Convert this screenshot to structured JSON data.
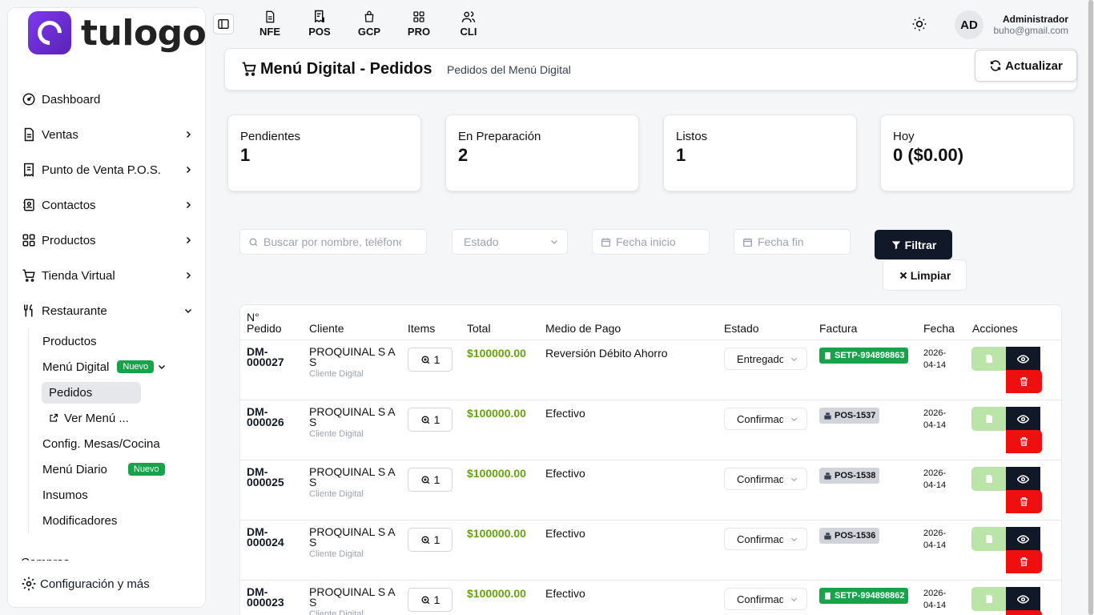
{
  "brand": {
    "name": "tulogo"
  },
  "sidebar": {
    "items": [
      {
        "label": "Dashboard",
        "icon": "gauge-icon",
        "chevron": ""
      },
      {
        "label": "Ventas",
        "icon": "file-invoice-icon",
        "chevron": "right"
      },
      {
        "label": "Punto de Venta P.O.S.",
        "icon": "receipt-icon",
        "chevron": "right"
      },
      {
        "label": "Contactos",
        "icon": "address-book-icon",
        "chevron": "right"
      },
      {
        "label": "Productos",
        "icon": "grid-icon",
        "chevron": "right"
      },
      {
        "label": "Tienda Virtual",
        "icon": "cart-icon",
        "chevron": "right"
      },
      {
        "label": "Restaurante",
        "icon": "utensils-icon",
        "chevron": "down"
      }
    ],
    "restaurant_sub": {
      "productos": "Productos",
      "menu_digital": "Menú Digital",
      "menu_digital_badge": "Nuevo",
      "pedidos": "Pedidos",
      "ver_menu": "Ver Menú ...",
      "config_mesas": "Config. Mesas/Cocina",
      "menu_diario": "Menú Diario",
      "menu_diario_badge": "Nuevo",
      "insumos": "Insumos",
      "modificadores": "Modificadores"
    },
    "cut_item": "Compras",
    "footer": "Configuración y más"
  },
  "topbar": {
    "modules": [
      {
        "label": "NFE",
        "icon": "file-icon"
      },
      {
        "label": "POS",
        "icon": "receipt-dollar-icon"
      },
      {
        "label": "GCP",
        "icon": "bag-icon"
      },
      {
        "label": "PRO",
        "icon": "grid-icon"
      },
      {
        "label": "CLI",
        "icon": "users-icon"
      }
    ],
    "avatar": "AD",
    "user_name": "Administrador",
    "user_email": "buho@gmail.com"
  },
  "header": {
    "title": "Menú Digital - Pedidos",
    "subtitle": "Pedidos del Menú Digital",
    "refresh_label": "Actualizar"
  },
  "stats": [
    {
      "label": "Pendientes",
      "value": "1"
    },
    {
      "label": "En Preparación",
      "value": "2"
    },
    {
      "label": "Listos",
      "value": "1"
    },
    {
      "label": "Hoy",
      "value": "0 ($0.00)"
    }
  ],
  "filters": {
    "search_placeholder": "Buscar por nombre, teléfono",
    "estado_placeholder": "Estado",
    "fecha_inicio_placeholder": "Fecha inicio",
    "fecha_fin_placeholder": "Fecha fin",
    "filter_label": "Filtrar",
    "clear_label": "Limpiar"
  },
  "table": {
    "headers": {
      "pedido_1": "N°",
      "pedido_2": "Pedido",
      "cliente": "Cliente",
      "items": "Items",
      "total": "Total",
      "medio_pago": "Medio de Pago",
      "estado": "Estado",
      "factura": "Factura",
      "fecha": "Fecha",
      "acciones": "Acciones"
    },
    "rows": [
      {
        "id_1": "DM-",
        "id_2": "000027",
        "cliente_1": "PROQUINAL S A",
        "cliente_2": "S",
        "cliente_sub": "Cliente Digital",
        "items": "1",
        "total": "$100000.00",
        "pago": "Reversión Débito Ahorro",
        "estado": "Entregado",
        "factura": "SETP-994898863",
        "factura_type": "green",
        "fecha_1": "2026-",
        "fecha_2": "04-14"
      },
      {
        "id_1": "DM-",
        "id_2": "000026",
        "cliente_1": "PROQUINAL S A",
        "cliente_2": "S",
        "cliente_sub": "Cliente Digital",
        "items": "1",
        "total": "$100000.00",
        "pago": "Efectivo",
        "estado": "Confirmado",
        "factura": "POS-1537",
        "factura_type": "gray",
        "fecha_1": "2026-",
        "fecha_2": "04-14"
      },
      {
        "id_1": "DM-",
        "id_2": "000025",
        "cliente_1": "PROQUINAL S A",
        "cliente_2": "S",
        "cliente_sub": "Cliente Digital",
        "items": "1",
        "total": "$100000.00",
        "pago": "Efectivo",
        "estado": "Confirmado",
        "factura": "POS-1538",
        "factura_type": "gray",
        "fecha_1": "2026-",
        "fecha_2": "04-14"
      },
      {
        "id_1": "DM-",
        "id_2": "000024",
        "cliente_1": "PROQUINAL S A",
        "cliente_2": "S",
        "cliente_sub": "Cliente Digital",
        "items": "1",
        "total": "$100000.00",
        "pago": "Efectivo",
        "estado": "Confirmado",
        "factura": "POS-1536",
        "factura_type": "gray",
        "fecha_1": "2026-",
        "fecha_2": "04-14"
      },
      {
        "id_1": "DM-",
        "id_2": "000023",
        "cliente_1": "PROQUINAL S A",
        "cliente_2": "S",
        "cliente_sub": "Cliente Digital",
        "items": "1",
        "total": "$100000.00",
        "pago": "Efectivo",
        "estado": "Confirmado",
        "factura": "SETP-994898862",
        "factura_type": "green",
        "fecha_1": "2026-",
        "fecha_2": "04-14"
      }
    ]
  },
  "colors": {
    "brand": "#6d28d9",
    "total_green": "#65a30d",
    "badge_green": "#16a34a",
    "dark_button": "#111827",
    "delete_red": "#ef0f0f",
    "doc_button": "#bbe5a8"
  }
}
